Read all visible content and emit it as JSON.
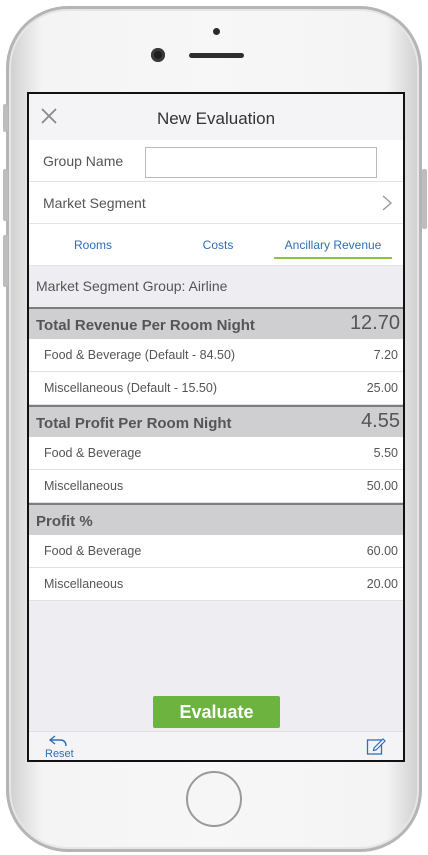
{
  "header": {
    "title": "New Evaluation"
  },
  "form": {
    "group_name_label": "Group Name",
    "group_name_value": "",
    "market_segment_label": "Market Segment"
  },
  "tabs": [
    {
      "label": "Rooms"
    },
    {
      "label": "Costs"
    },
    {
      "label": "Ancillary Revenue",
      "active": true
    }
  ],
  "segment": {
    "label": "Market Segment Group: Airline"
  },
  "revenue": {
    "title": "Total Revenue Per Room Night",
    "total": "12.70",
    "items": [
      {
        "label": "Food & Beverage (Default - 84.50)",
        "value": "7.20"
      },
      {
        "label": "Miscellaneous (Default - 15.50)",
        "value": "25.00"
      }
    ]
  },
  "profit": {
    "title": "Total Profit Per Room Night",
    "total": "4.55",
    "items": [
      {
        "label": "Food & Beverage",
        "value": "5.50"
      },
      {
        "label": "Miscellaneous",
        "value": "50.00"
      }
    ]
  },
  "profit_pct": {
    "title": "Profit %",
    "items": [
      {
        "label": "Food & Beverage",
        "value": "60.00"
      },
      {
        "label": "Miscellaneous",
        "value": "20.00"
      }
    ]
  },
  "actions": {
    "evaluate_label": "Evaluate"
  },
  "footer": {
    "reset_label": "Reset"
  },
  "colors": {
    "accent_green": "#6cb33f",
    "tab_underline": "#8cc63f",
    "link_blue": "#2f6fb5"
  },
  "icons": {
    "close": "close-icon",
    "chevron": "chevron-right-icon",
    "reset": "reset-icon",
    "edit": "edit-icon"
  }
}
